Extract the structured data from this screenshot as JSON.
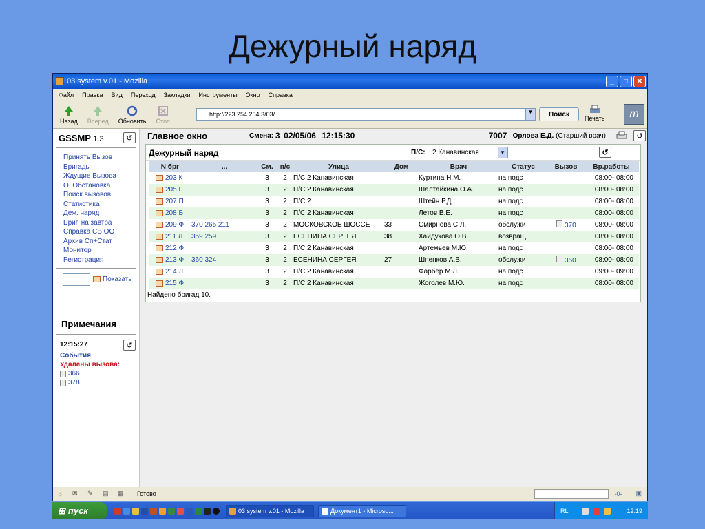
{
  "slide_title": "Дежурный наряд",
  "window": {
    "title": "03 system v.01 - Mozilla"
  },
  "menu": [
    "Файл",
    "Правка",
    "Вид",
    "Переход",
    "Закладки",
    "Инструменты",
    "Окно",
    "Справка"
  ],
  "toolbar": {
    "back": "Назад",
    "forward": "Вперед",
    "reload": "Обновить",
    "stop": "Стоп",
    "url": "http://223.254.254.3/03/",
    "search": "Поиск",
    "print": "Печать"
  },
  "sidebar": {
    "app_name": "GSSMP",
    "version": "1.3",
    "nav": [
      "Принять Вызов",
      "Бригады",
      "Ждущие Вызова",
      "О. Обстановка",
      "Поиск вызовов",
      "Статистика",
      "Деж. наряд",
      "Бриг. на завтра",
      "Справка СВ ОО",
      "Архив Сп+Стат",
      "Монитор",
      "Регистрация"
    ],
    "show_label": "Показать",
    "notes_title": "Примечания",
    "note_time": "12:15:27",
    "events_label": "События",
    "deleted_label": "Удалены вызова:",
    "deleted_calls": [
      "366",
      "378"
    ]
  },
  "header": {
    "main_title": "Главное окно",
    "shift_label": "Смена:",
    "shift_value": "3",
    "date": "02/05/06",
    "time": "12:15:30",
    "operator_id": "7007",
    "operator_name": "Орлова Е.Д.",
    "operator_role": "(Старший врач)"
  },
  "panel": {
    "title": "Дежурный наряд",
    "ps_label": "П/С:",
    "ps_value": "2 Канавинская",
    "columns": [
      "N бpг",
      "...",
      "См.",
      "п/с",
      "Улица",
      "Дом",
      "Врач",
      "Статус",
      "Вызов",
      "Вр.работы"
    ],
    "rows": [
      [
        "203 К",
        "",
        "3",
        "2",
        "П/С 2 Канавинская",
        "",
        "Куртина Н.М.",
        "на подс",
        "",
        "08:00- 08:00"
      ],
      [
        "205 Е",
        "",
        "3",
        "2",
        "П/С 2 Канавинская",
        "",
        "Шалтайкина О.А.",
        "на подс",
        "",
        "08:00- 08:00"
      ],
      [
        "207 П",
        "",
        "3",
        "2",
        "П/С 2",
        "",
        "Штейн Р.Д.",
        "на подс",
        "",
        "08:00- 08:00"
      ],
      [
        "208 Б",
        "",
        "3",
        "2",
        "П/С 2 Канавинская",
        "",
        "Летов В.Е.",
        "на подс",
        "",
        "08:00- 08:00"
      ],
      [
        "209 Ф",
        "370 265 211",
        "3",
        "2",
        "МОСКОВСКОЕ ШОССЕ",
        "33",
        "Смирнова С.Л.",
        "обслужи",
        "370",
        "08:00- 08:00"
      ],
      [
        "211 Л",
        "359 259",
        "3",
        "2",
        "ЕСЕНИНА СЕРГЕЯ",
        "38",
        "Хайдукова О.В.",
        "возвращ",
        "",
        "08:00- 08:00"
      ],
      [
        "212 Ф",
        "",
        "3",
        "2",
        "П/С 2 Канавинская",
        "",
        "Артемьев М.Ю.",
        "на подс",
        "",
        "08:00- 08:00"
      ],
      [
        "213 Ф",
        "360 324",
        "3",
        "2",
        "ЕСЕНИНА СЕРГЕЯ",
        "27",
        "Шпенков А.В.",
        "обслужи",
        "360",
        "08:00- 08:00"
      ],
      [
        "214 Л",
        "",
        "3",
        "2",
        "П/С 2 Канавинская",
        "",
        "Фарбер М.Л.",
        "на подс",
        "",
        "09:00- 09:00"
      ],
      [
        "215 Ф",
        "",
        "3",
        "2",
        "П/С 2 Канавинская",
        "",
        "Жоголев М.Ю.",
        "на подс",
        "",
        "08:00- 08:00"
      ]
    ],
    "found": "Найдено бригад 10."
  },
  "status": {
    "text": "Готово"
  },
  "taskbar": {
    "start": "пуск",
    "items": [
      "03 system v.01 - Mozilla",
      "Документ1 - Microso..."
    ],
    "lang": "RL",
    "clock": "12:19"
  },
  "colors": {
    "slide_bg": "#6a9ae6",
    "title_bar": "#0a5ed9",
    "link": "#2646a8",
    "deleted": "#c0101a",
    "row_alt": "#e5f6e5",
    "table_head": "#cfdbe8"
  },
  "icons": [
    "back-arrow-icon",
    "forward-arrow-icon",
    "reload-icon",
    "stop-icon",
    "print-icon",
    "refresh-icon",
    "list-icon",
    "document-icon"
  ]
}
